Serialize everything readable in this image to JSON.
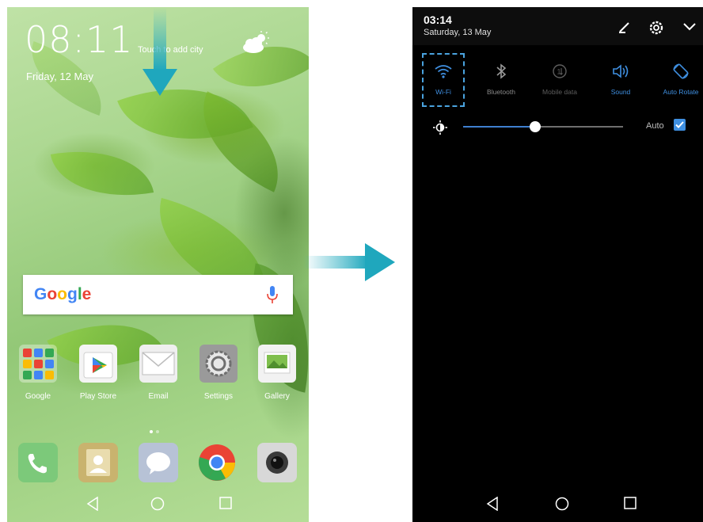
{
  "home_screen": {
    "time": "08:11",
    "date": "Friday, 12 May",
    "weather_prompt": "Touch to add city",
    "weather_icon": "partly-cloudy-icon",
    "search": {
      "logo_text": "Google",
      "mic_icon": "microphone-icon"
    },
    "apps": [
      {
        "label": "Google",
        "icon": "google-folder-icon"
      },
      {
        "label": "Play Store",
        "icon": "play-store-icon"
      },
      {
        "label": "Email",
        "icon": "email-icon"
      },
      {
        "label": "Settings",
        "icon": "settings-icon"
      },
      {
        "label": "Gallery",
        "icon": "gallery-icon"
      }
    ],
    "page_indicator": {
      "pages": 2,
      "active": 1
    },
    "dock": [
      {
        "icon": "phone-icon"
      },
      {
        "icon": "contacts-icon"
      },
      {
        "icon": "messages-icon"
      },
      {
        "icon": "chrome-icon"
      },
      {
        "icon": "camera-icon"
      }
    ],
    "nav": [
      "back-icon",
      "home-icon",
      "recents-icon"
    ]
  },
  "notification_panel": {
    "time": "03:14",
    "date": "Saturday, 13 May",
    "header_icons": [
      "edit-icon",
      "settings-gear-icon",
      "collapse-chevron-icon"
    ],
    "toggles": [
      {
        "label": "Wi-Fi",
        "icon": "wifi-icon",
        "active": true,
        "color": "#3f8fe0"
      },
      {
        "label": "Bluetooth",
        "icon": "bluetooth-icon",
        "active": false,
        "color": "#8a8a8a"
      },
      {
        "label": "Mobile data",
        "icon": "mobile-data-icon",
        "active": false,
        "color": "#5e5e5e"
      },
      {
        "label": "Sound",
        "icon": "sound-icon",
        "active": true,
        "color": "#3f8fe0"
      },
      {
        "label": "Auto Rotate",
        "icon": "auto-rotate-icon",
        "active": true,
        "color": "#3f8fe0"
      }
    ],
    "brightness": {
      "level": 0.45,
      "auto_label": "Auto",
      "auto_checked": true
    },
    "nav": [
      "back-icon",
      "home-icon",
      "recents-icon"
    ]
  },
  "colors": {
    "accent": "#3f8fe0",
    "arrow": "#34b3c4"
  }
}
